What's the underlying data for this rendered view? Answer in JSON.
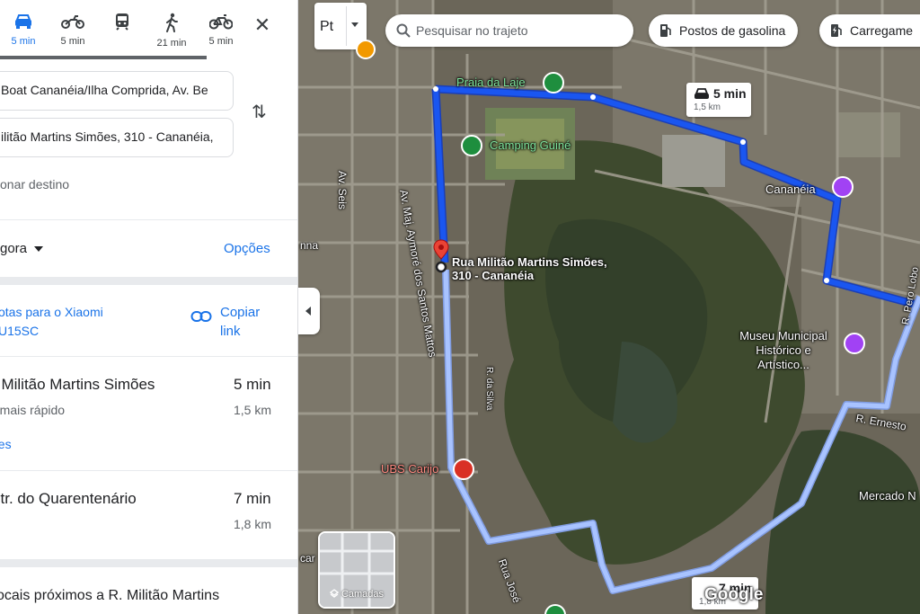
{
  "travel_modes": [
    {
      "name": "car",
      "time": "5 min"
    },
    {
      "name": "motorcycle",
      "time": "5 min"
    },
    {
      "name": "transit",
      "time": ""
    },
    {
      "name": "walking",
      "time": "21 min"
    },
    {
      "name": "cycling",
      "time": "5 min"
    }
  ],
  "directions": {
    "origin": "Boat Cananéia/Ilha Comprida, Av. Be",
    "destination": "ilitão Martins Simões, 310 - Cananéia,",
    "add_destination": "onar destino"
  },
  "depart": {
    "label": "gora",
    "options": "Opções"
  },
  "share": {
    "send_to_phone": "otas para o Xiaomi U15SC",
    "copy_link": "Copiar link"
  },
  "routes": [
    {
      "name": ". Militão Martins Simões",
      "time": "5 min",
      "distance": "1,5 km",
      "subtitle": "o mais rápido",
      "details": "hes"
    },
    {
      "name": "str. do Quarentenário",
      "time": "7 min",
      "distance": "1,8 km"
    }
  ],
  "nearby": "ocais próximos a R. Militão Martins",
  "map": {
    "map_type_label": "Pt",
    "search_placeholder": "Pesquisar no trajeto",
    "chips": [
      "Postos de gasolina",
      "Carregame"
    ],
    "destination_label": "Rua Militão Martins Simões, 310 - Cananéia",
    "places": {
      "praia": "Praia da Laje",
      "camping": "Camping Guiné",
      "cananeia": "Cananéia",
      "museu": "Museu Municipal Histórico e Artístico...",
      "ubs": "UBS Carijo",
      "mercado": "Mercado N"
    },
    "roads": {
      "av_seis": "Av. Seis",
      "av_maj": "Av. Maj. Aymoré dos Santos Mattos",
      "r_silva": "R. da Silva",
      "rua_jose": "Rua José",
      "r_ernesto": "R. Ernesto",
      "r_pero": "R. Pero Lobo",
      "nna": "nna",
      "car": "car"
    },
    "route_callout": {
      "time": "5 min",
      "distance": "1,5 km"
    },
    "alt_callout": {
      "time": "7 min",
      "distance": "1,8 km"
    },
    "layers_label": "Camadas",
    "attribution": "Google",
    "colors": {
      "primary_route": "#1a56f0",
      "alt_route": "#a8c3ff",
      "accent": "#1a73e8"
    }
  }
}
